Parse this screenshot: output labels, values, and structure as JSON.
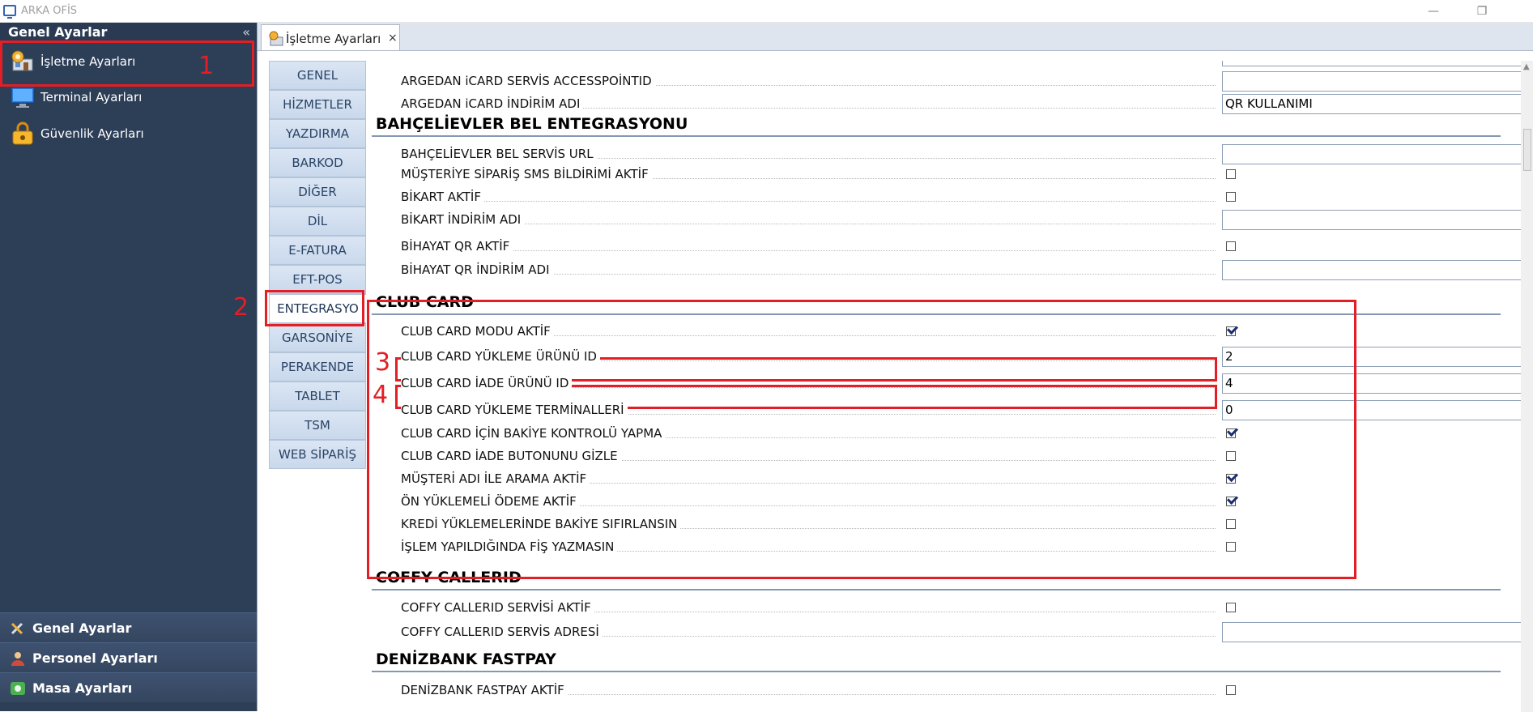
{
  "window": {
    "title": "ARKA OFİS",
    "minimize": "—",
    "restore": "❐",
    "close": "✕"
  },
  "sidebar": {
    "header": "Genel Ayarlar",
    "collapse": "«",
    "items": [
      {
        "label": "İşletme Ayarları",
        "icon": "business-settings-icon"
      },
      {
        "label": "Terminal Ayarları",
        "icon": "monitor-icon"
      },
      {
        "label": "Güvenlik Ayarları",
        "icon": "padlock-icon"
      }
    ],
    "bottom_groups": [
      {
        "label": "Genel Ayarlar",
        "icon": "tools-icon"
      },
      {
        "label": "Personel Ayarları",
        "icon": "person-icon"
      },
      {
        "label": "Masa Ayarları",
        "icon": "table-icon"
      }
    ]
  },
  "doc_tab": {
    "label": "İşletme Ayarları",
    "close": "×"
  },
  "vertical_tabs": [
    "GENEL",
    "HİZMETLER",
    "YAZDIRMA",
    "BARKOD",
    "DİĞER",
    "DİL",
    "E-FATURA",
    "EFT-POS",
    "ENTEGRASYO",
    "GARSONİYE",
    "PERAKENDE",
    "TABLET",
    "TSM",
    "WEB SİPARİŞ"
  ],
  "active_tab": "ENTEGRASYO",
  "settings": {
    "argedan": [
      {
        "label": "ARGEDAN iCARD SERVİS ACCESSPOİNTID",
        "type": "text",
        "value": ""
      },
      {
        "label": "ARGEDAN iCARD İNDİRİM ADI",
        "type": "text",
        "value": "QR KULLANIMI"
      }
    ],
    "bahcelievler": {
      "title": "BAHÇELİEVLER BEL ENTEGRASYONU",
      "rows": [
        {
          "label": "BAHÇELİEVLER BEL SERVİS URL",
          "type": "text",
          "value": ""
        },
        {
          "label": "MÜŞTERİYE SİPARİŞ SMS BİLDİRİMİ AKTİF",
          "type": "check",
          "checked": false
        },
        {
          "label": "BİKART AKTİF",
          "type": "check",
          "checked": false
        },
        {
          "label": "BİKART İNDİRİM ADI",
          "type": "text",
          "value": ""
        },
        {
          "label": "BİHAYAT QR AKTİF",
          "type": "check",
          "checked": false
        },
        {
          "label": "BİHAYAT QR İNDİRİM ADI",
          "type": "text",
          "value": ""
        }
      ]
    },
    "club_card": {
      "title": "CLUB CARD",
      "rows": [
        {
          "label": "CLUB CARD MODU AKTİF",
          "type": "check",
          "checked": true
        },
        {
          "label": "CLUB CARD YÜKLEME ÜRÜNÜ ID",
          "type": "text",
          "value": "2"
        },
        {
          "label": "CLUB CARD İADE ÜRÜNÜ ID",
          "type": "text",
          "value": "4"
        },
        {
          "label": "CLUB CARD YÜKLEME TERMİNALLERİ",
          "type": "text",
          "value": "0"
        },
        {
          "label": "CLUB CARD İÇİN BAKİYE KONTROLÜ YAPMA",
          "type": "check",
          "checked": true
        },
        {
          "label": "CLUB CARD İADE BUTONUNU GİZLE",
          "type": "check",
          "checked": false
        },
        {
          "label": "MÜŞTERİ ADI İLE ARAMA AKTİF",
          "type": "check",
          "checked": true
        },
        {
          "label": "ÖN YÜKLEMELİ ÖDEME AKTİF",
          "type": "check",
          "checked": true
        },
        {
          "label": "KREDİ YÜKLEMELERİNDE BAKİYE SIFIRLANSIN",
          "type": "check",
          "checked": false
        },
        {
          "label": "İŞLEM YAPILDIĞINDA FİŞ YAZMASIN",
          "type": "check",
          "checked": false
        }
      ]
    },
    "coffy": {
      "title": "COFFY CALLERID",
      "rows": [
        {
          "label": "COFFY CALLERID SERVİSİ AKTİF",
          "type": "check",
          "checked": false
        },
        {
          "label": "COFFY CALLERID SERVİS ADRESİ",
          "type": "text",
          "value": ""
        }
      ]
    },
    "denizbank": {
      "title": "DENİZBANK FASTPAY",
      "rows": [
        {
          "label": "DENİZBANK FASTPAY AKTİF",
          "type": "check",
          "checked": false
        }
      ]
    }
  },
  "annotations": [
    "1",
    "2",
    "3",
    "4"
  ],
  "colors": {
    "annotation": "#e31e24",
    "sidebar_bg": "#2d3e57",
    "tab_bg": "#c9d8ec"
  }
}
